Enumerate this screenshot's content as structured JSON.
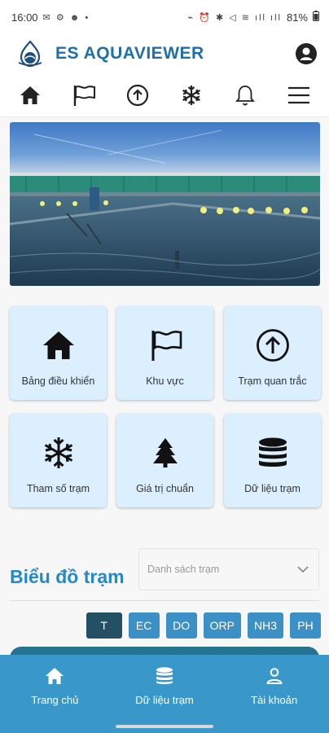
{
  "status_bar": {
    "time": "16:00",
    "left_icons": "✉ ⚙ ☻ •",
    "right_icons": "⌁ ⏰ ✱ ◁ ≋ ıll ıll",
    "battery": "81%"
  },
  "header": {
    "title": "ES AQUAVIEWER"
  },
  "top_nav": [
    {
      "icon": "home-icon"
    },
    {
      "icon": "flag-icon"
    },
    {
      "icon": "arrow-up-circle-icon"
    },
    {
      "icon": "snowflake-icon"
    },
    {
      "icon": "bell-icon"
    },
    {
      "icon": "menu-icon"
    }
  ],
  "tiles": [
    {
      "label": "Bảng điều khiển",
      "icon": "home-icon"
    },
    {
      "label": "Khu vực",
      "icon": "flag-icon"
    },
    {
      "label": "Trạm quan trắc",
      "icon": "arrow-up-circle-icon"
    },
    {
      "label": "Tham số trạm",
      "icon": "snowflake-icon"
    },
    {
      "label": "Giá trị chuẩn",
      "icon": "tree-icon"
    },
    {
      "label": "Dữ liệu trạm",
      "icon": "database-icon"
    }
  ],
  "chart_section": {
    "title": "Biểu đồ trạm",
    "select_placeholder": "Danh sách trạm",
    "params": [
      "T",
      "EC",
      "DO",
      "ORP",
      "NH3",
      "PH"
    ],
    "active_param": "T"
  },
  "bottom_nav": [
    {
      "label": "Trang chủ",
      "icon": "home-icon"
    },
    {
      "label": "Dữ liệu trạm",
      "icon": "database-icon"
    },
    {
      "label": "Tài khoản",
      "icon": "user-icon"
    }
  ],
  "colors": {
    "brand": "#1f6fa8",
    "accent": "#3b90c6",
    "active_param": "#245064",
    "tile_bg": "#dcefff",
    "bottom_nav": "#3a97c9"
  }
}
